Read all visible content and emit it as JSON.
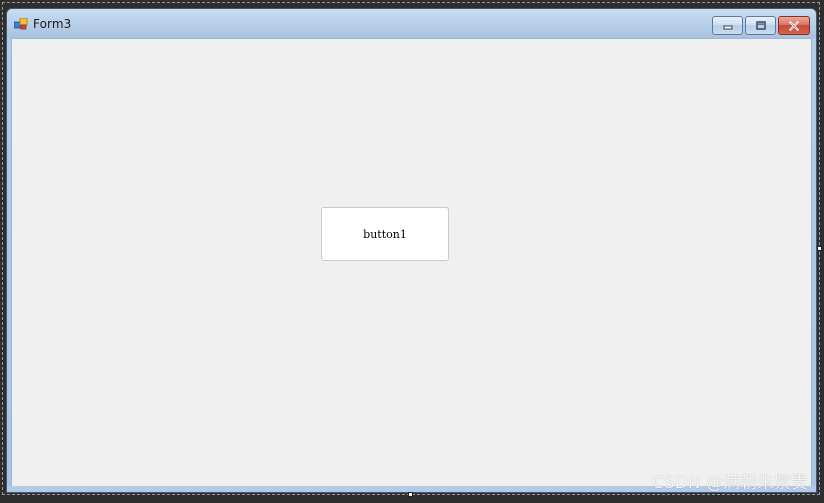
{
  "window": {
    "title": "Form3",
    "app_icon": "winforms-form-icon",
    "caption_buttons": {
      "minimize": "minimize-icon",
      "maximize": "maximize-icon",
      "close": "close-icon"
    }
  },
  "form": {
    "button_label": "button1"
  },
  "watermark": {
    "text": "CSDN @满朝朱紫贵"
  },
  "colors": {
    "client_background": "#f0f0f0",
    "title_bar": "#b8cfe9",
    "close_button": "#c44b34"
  }
}
